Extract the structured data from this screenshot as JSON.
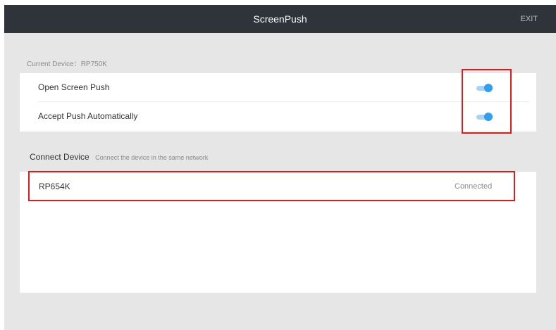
{
  "caption": "",
  "app": {
    "title": "ScreenPush",
    "exit_label": "EXIT"
  },
  "current_device": {
    "label": "Current Device：RP750K"
  },
  "settings": [
    {
      "label": "Open Screen Push",
      "enabled": true
    },
    {
      "label": "Accept Push Automatically",
      "enabled": true
    }
  ],
  "connect": {
    "title": "Connect Device",
    "subtitle": "Connect the device in the same network"
  },
  "devices": [
    {
      "name": "RP654K",
      "status": "Connected"
    }
  ],
  "colors": {
    "titlebar": "#2e3439",
    "background": "#e6e6e6",
    "toggle_on": "#2f9ff0",
    "highlight": "#e01b1b"
  }
}
